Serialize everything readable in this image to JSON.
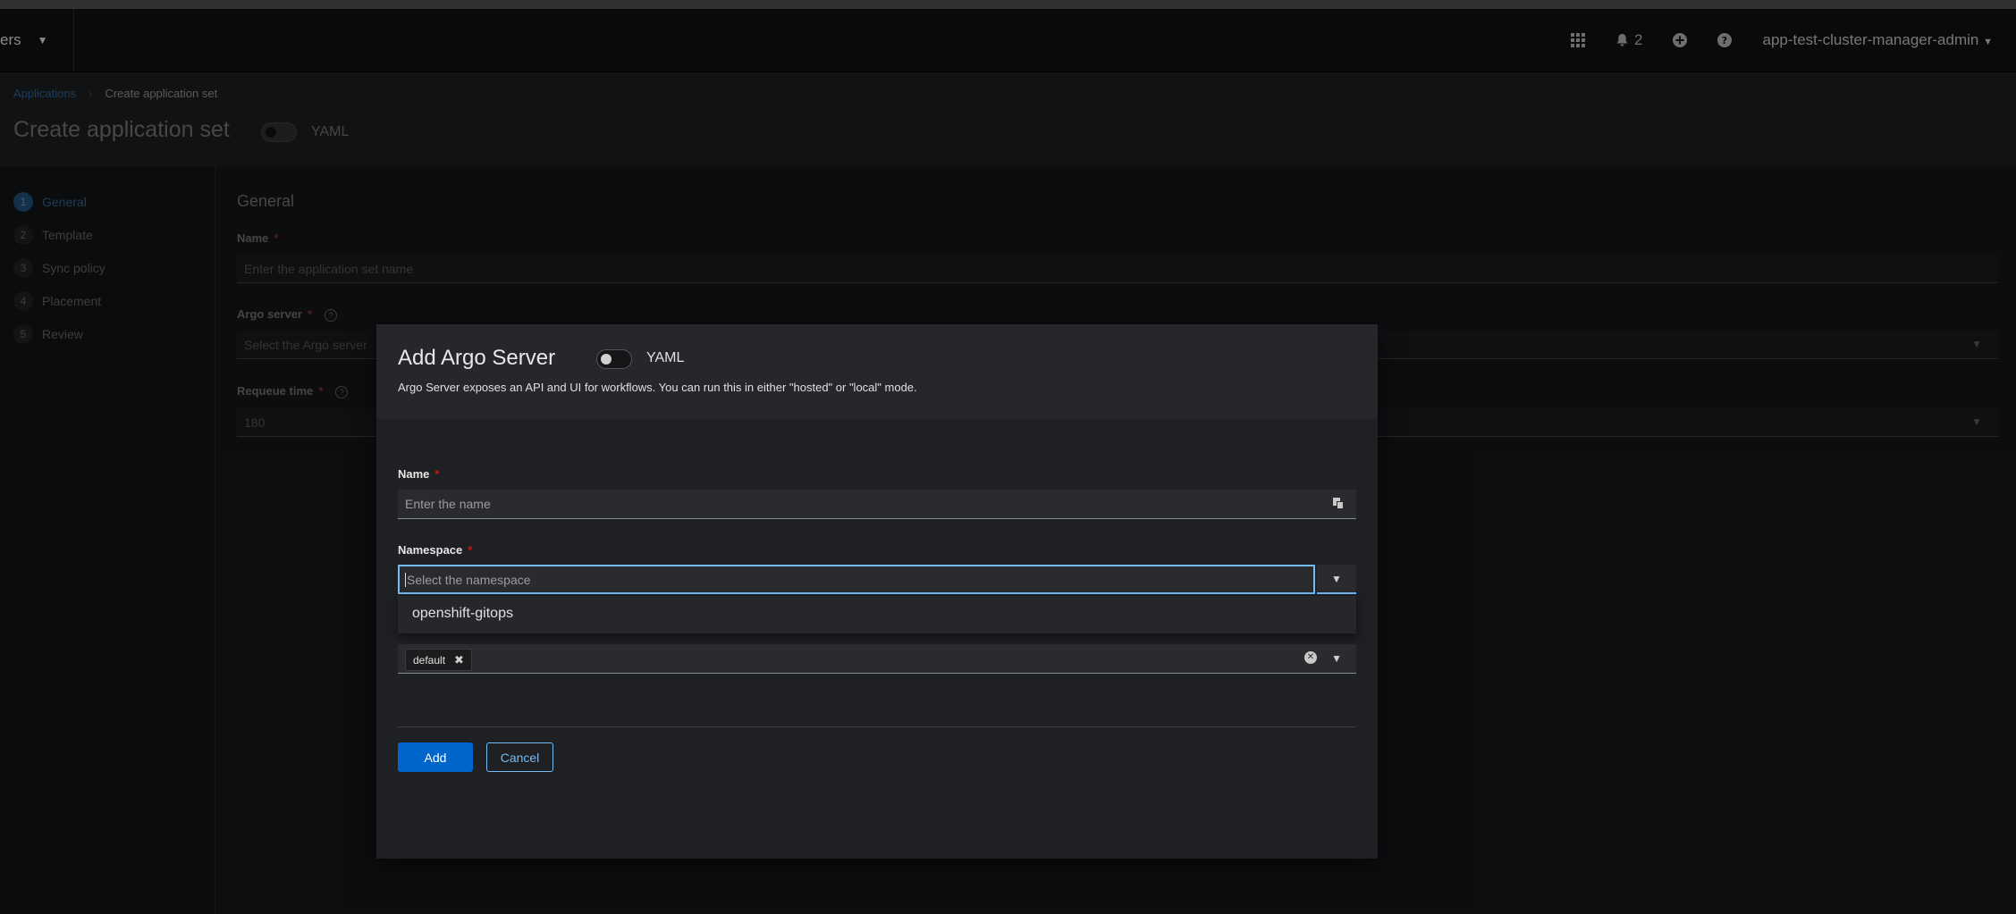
{
  "masthead": {
    "perspective_label": "ers",
    "notification_count": "2",
    "user_label": "app-test-cluster-manager-admin"
  },
  "page": {
    "breadcrumb": {
      "link": "Applications",
      "current": "Create application set"
    },
    "title": "Create application set",
    "yaml_label": "YAML"
  },
  "wizard": {
    "steps": [
      {
        "num": "1",
        "label": "General"
      },
      {
        "num": "2",
        "label": "Template"
      },
      {
        "num": "3",
        "label": "Sync policy"
      },
      {
        "num": "4",
        "label": "Placement"
      },
      {
        "num": "5",
        "label": "Review"
      }
    ]
  },
  "form": {
    "section_title": "General",
    "name_label": "Name",
    "name_placeholder": "Enter the application set name",
    "argo_label": "Argo server",
    "argo_placeholder": "Select the Argo server",
    "requeue_label": "Requeue time",
    "requeue_value": "180"
  },
  "modal": {
    "title": "Add Argo Server",
    "yaml_label": "YAML",
    "description": "Argo Server exposes an API and UI for workflows. You can run this in either \"hosted\" or \"local\" mode.",
    "name_label": "Name",
    "name_placeholder": "Enter the name",
    "namespace_label": "Namespace",
    "namespace_placeholder": "Select the namespace",
    "namespace_options": [
      "openshift-gitops"
    ],
    "chip_label": "default",
    "add_label": "Add",
    "cancel_label": "Cancel"
  },
  "colors": {
    "primary": "#0066cc",
    "focus": "#73bcf7",
    "required": "#c9190b"
  }
}
